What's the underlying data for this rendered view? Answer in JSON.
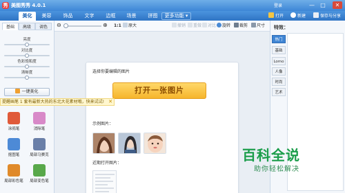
{
  "app": {
    "title": "美图秀秀 4.0.1",
    "logo": "秀"
  },
  "titlebar": {
    "login": "登录",
    "min": "—",
    "max": "□",
    "close": "✕"
  },
  "main_tabs": [
    {
      "label": "美化",
      "active": true
    },
    {
      "label": "美容"
    },
    {
      "label": "饰品"
    },
    {
      "label": "文字"
    },
    {
      "label": "边框"
    },
    {
      "label": "场景"
    },
    {
      "label": "拼图"
    },
    {
      "label": "更多功能 ▾"
    }
  ],
  "top_actions": {
    "open": "打开",
    "new": "新建",
    "save": "保存与分享"
  },
  "left": {
    "subtabs": [
      "基础",
      "高级",
      "调色"
    ],
    "sliders": [
      {
        "label": "亮度",
        "level": 0.5
      },
      {
        "label": "对比度",
        "level": 0.5
      },
      {
        "label": "色彩饱和度",
        "level": 0.5
      },
      {
        "label": "清晰度",
        "level": 0.5
      }
    ],
    "onekey_label": "一键美化",
    "tools": [
      {
        "label": "涂鸦笔",
        "icon": "doodle-pen-icon",
        "color": "#e05a3a"
      },
      {
        "label": "消除笔",
        "icon": "eraser-pen-icon",
        "color": "#d889c8"
      },
      {
        "label": "抠图笔",
        "icon": "cutout-pen-icon",
        "color": "#4d8ad6"
      },
      {
        "label": "局部马赛克",
        "icon": "mosaic-icon",
        "color": "#6a7fa8"
      },
      {
        "label": "局部彩色笔",
        "icon": "color-pen-icon",
        "color": "#e08a2a"
      },
      {
        "label": "局部变色笔",
        "icon": "recolor-pen-icon",
        "color": "#58a84a"
      }
    ]
  },
  "toolbar": {
    "zoom_level": 0.0,
    "one_to_one": "1:1",
    "original": "原大",
    "rotate": "旋转",
    "crop": "裁剪",
    "resize": "尺寸",
    "undo": "撤销",
    "redo": "重做",
    "compare": "对比"
  },
  "canvas": {
    "choose_title": "选择你要编辑的图片",
    "open_button": "打开一张图片",
    "examples_label": "示例图片：",
    "recent_label": "近期打开图片："
  },
  "notice": {
    "text": "提醒画笔 1 套有最新大热的东北大花素材哦，快来试试!",
    "close": "✕"
  },
  "right": {
    "title": "特效：",
    "categories": [
      {
        "label": "热门",
        "active": true
      },
      {
        "label": "基础"
      },
      {
        "label": "Lomo"
      },
      {
        "label": "人像"
      },
      {
        "label": "时尚"
      },
      {
        "label": "艺术"
      }
    ]
  },
  "watermark": {
    "title": "百科全说",
    "subtitle": "助你轻松解决"
  }
}
